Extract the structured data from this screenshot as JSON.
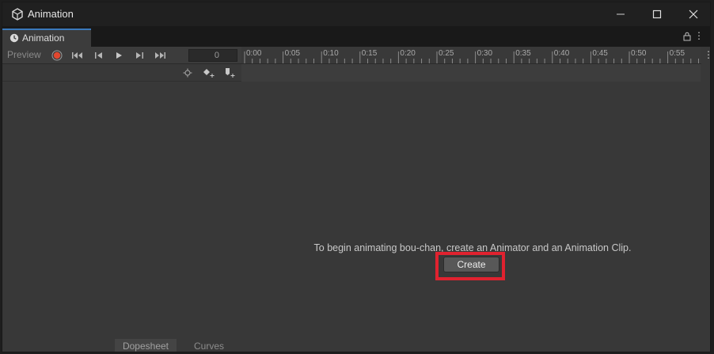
{
  "window": {
    "title": "Animation",
    "tab_label": "Animation"
  },
  "controls": {
    "preview_label": "Preview",
    "frame_value": "0"
  },
  "timeline": {
    "ticks": [
      "0:00",
      "0:05",
      "0:10",
      "0:15",
      "0:20",
      "0:25",
      "0:30",
      "0:35",
      "0:40",
      "0:45",
      "0:50",
      "0:55"
    ]
  },
  "main": {
    "message": "To begin animating bou-chan, create an Animator and an Animation Clip.",
    "create_label": "Create"
  },
  "bottom_tabs": {
    "dopesheet": "Dopesheet",
    "curves": "Curves"
  },
  "colors": {
    "accent": "#3a79bb",
    "record": "#e0472f",
    "highlight": "#e0222f"
  }
}
